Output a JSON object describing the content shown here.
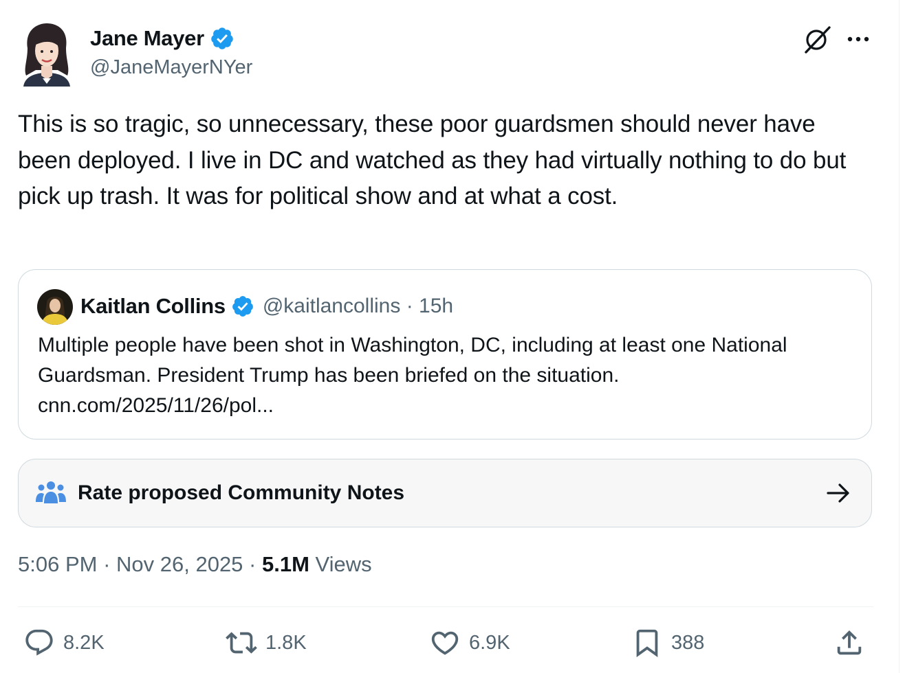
{
  "author": {
    "name": "Jane Mayer",
    "handle": "@JaneMayerNYer",
    "verified_icon": "verified-badge-icon",
    "avatar_icon": "avatar-jane-mayer"
  },
  "header_icons": [
    "grok-icon",
    "more-icon"
  ],
  "tweet": {
    "text": "This is so tragic, so unnecessary, these poor guardsmen should never have been deployed. I live in DC and watched as they had virtually nothing to do but pick up trash. It was for political show and at what a cost."
  },
  "quote": {
    "name": "Kaitlan Collins",
    "handle": "@kaitlancollins",
    "separator": "·",
    "time": "15h",
    "text": "Multiple people have been shot in Washington, DC, including at least one National Guardsman. President Trump has been briefed on the situation.",
    "link": "cnn.com/2025/11/26/pol..."
  },
  "community_notes": {
    "label": "Rate proposed Community Notes",
    "icon": "people-icon",
    "arrow_icon": "arrow-right-icon"
  },
  "meta": {
    "time": "5:06 PM",
    "separator": " · ",
    "date": "Nov 26, 2025",
    "separator2": " · ",
    "views_count": "5.1M",
    "views_label": " Views"
  },
  "actions": {
    "replies": "8.2K",
    "reposts": "1.8K",
    "likes": "6.9K",
    "bookmarks": "388"
  },
  "colors": {
    "text": "#0f1419",
    "secondary": "#536471",
    "verified": "#1d9bf0",
    "border": "#cfd9de",
    "notes_icon": "#1d9bf0"
  }
}
